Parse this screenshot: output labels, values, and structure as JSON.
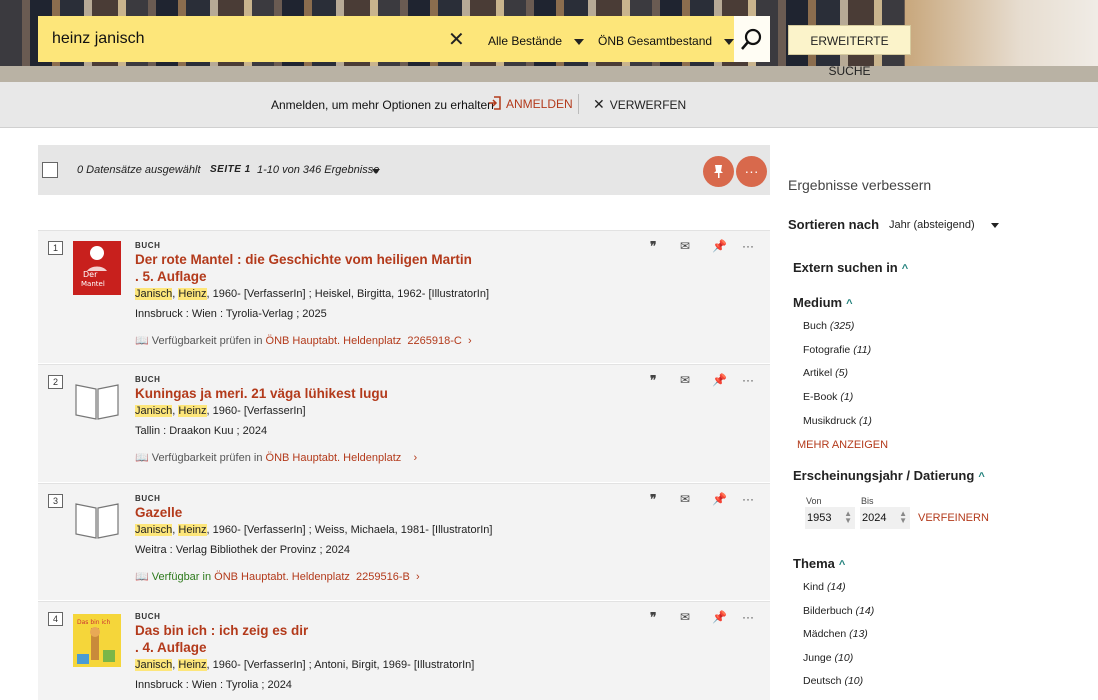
{
  "search": {
    "query": "heinz janisch",
    "scope1": "Alle Bestände",
    "scope2": "ÖNB Gesamtbestand",
    "advanced": "ERWEITERTE SUCHE"
  },
  "loginbar": {
    "message": "Anmelden, um mehr Optionen zu erhalten",
    "login": "ANMELDEN",
    "dismiss": "VERWERFEN"
  },
  "toolbar": {
    "selected": "0 Datensätze ausgewählt",
    "page": "SEITE 1",
    "range": "1-10 von 346 Ergebnisse"
  },
  "results": [
    {
      "num": "1",
      "type": "BUCH",
      "title1": "Der rote Mantel : die Geschichte vom heiligen Martin",
      "title2": ". 5. Auflage",
      "author_a": "Janisch",
      "author_b": "Heinz",
      "author_rest": ", 1960- [VerfasserIn] ; Heiskel, Birgitta, 1962- [IllustratorIn]",
      "pub": "Innsbruck : Wien : Tyrolia-Verlag ; 2025",
      "avail_status": "Verfügbarkeit prüfen in",
      "avail_loc": "ÖNB Hauptabt. Heldenplatz",
      "avail_sig": "2265918-C",
      "available": false,
      "thumb": "cover-red-mantel"
    },
    {
      "num": "2",
      "type": "BUCH",
      "title1": "Kuningas ja meri. 21 väga lühikest lugu",
      "title2": "",
      "author_a": "Janisch",
      "author_b": "Heinz",
      "author_rest": ", 1960- [VerfasserIn]",
      "pub": "Tallin : Draakon Kuu ; 2024",
      "avail_status": "Verfügbarkeit prüfen in",
      "avail_loc": "ÖNB Hauptabt. Heldenplatz",
      "avail_sig": "",
      "available": false,
      "thumb": "book-placeholder"
    },
    {
      "num": "3",
      "type": "BUCH",
      "title1": "Gazelle",
      "title2": "",
      "author_a": "Janisch",
      "author_b": "Heinz",
      "author_rest": ", 1960- [VerfasserIn] ; Weiss, Michaela, 1981- [IllustratorIn]",
      "pub": "Weitra : Verlag Bibliothek der Provinz ; 2024",
      "avail_status": "Verfügbar in",
      "avail_loc": "ÖNB Hauptabt. Heldenplatz",
      "avail_sig": "2259516-B",
      "available": true,
      "thumb": "book-placeholder"
    },
    {
      "num": "4",
      "type": "BUCH",
      "title1": "Das bin ich : ich zeig es dir",
      "title2": ". 4. Auflage",
      "author_a": "Janisch",
      "author_b": "Heinz",
      "author_rest": ", 1960- [VerfasserIn] ; Antoni, Birgit, 1969- [IllustratorIn]",
      "pub": "Innsbruck : Wien : Tyrolia ; 2024",
      "avail_status": "",
      "avail_loc": "",
      "avail_sig": "",
      "available": false,
      "thumb": "cover-das-bin-ich"
    }
  ],
  "refine": {
    "heading": "Ergebnisse verbessern",
    "sort_label": "Sortieren nach",
    "sort_value": "Jahr (absteigend)",
    "extern": "Extern suchen in",
    "medium": "Medium",
    "medium_items": [
      {
        "label": "Buch",
        "count": "(325)"
      },
      {
        "label": "Fotografie",
        "count": "(11)"
      },
      {
        "label": "Artikel",
        "count": "(5)"
      },
      {
        "label": "E-Book",
        "count": "(1)"
      },
      {
        "label": "Musikdruck",
        "count": "(1)"
      }
    ],
    "more": "MEHR ANZEIGEN",
    "year_heading": "Erscheinungsjahr / Datierung",
    "from_label": "Von",
    "to_label": "Bis",
    "from_value": "1953",
    "to_value": "2024",
    "refine_btn": "VERFEINERN",
    "topic": "Thema",
    "topic_items": [
      {
        "label": "Kind",
        "count": "(14)"
      },
      {
        "label": "Bilderbuch",
        "count": "(14)"
      },
      {
        "label": "Mädchen",
        "count": "(13)"
      },
      {
        "label": "Junge",
        "count": "(10)"
      },
      {
        "label": "Deutsch",
        "count": "(10)"
      }
    ]
  },
  "colors": {
    "accent": "#b33a1b",
    "search_bg": "#fde67a",
    "highlight": "#fde67a",
    "available": "#2d7a1c"
  }
}
